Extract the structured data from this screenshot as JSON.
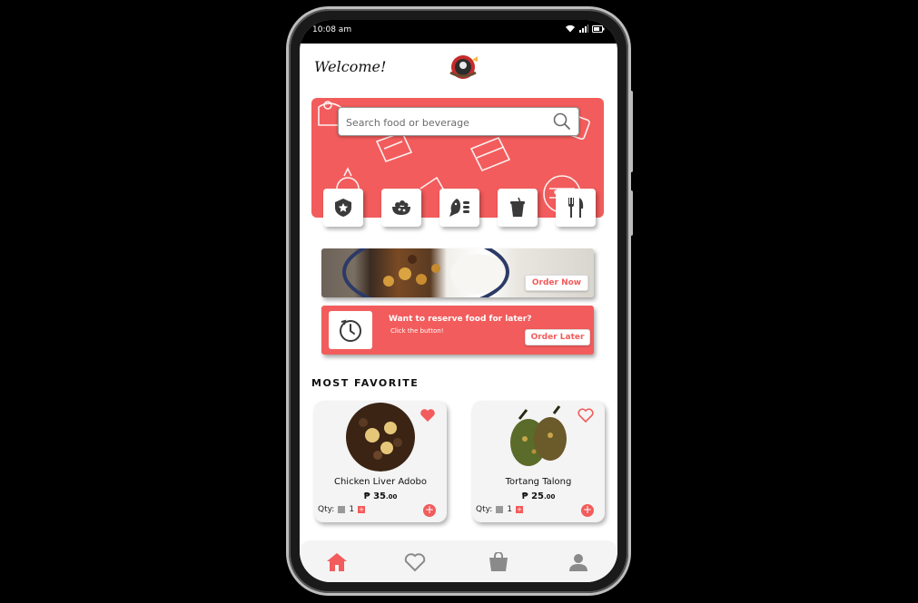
{
  "status_bar": {
    "time": "10:08 am"
  },
  "header": {
    "welcome": "Welcome!"
  },
  "search": {
    "placeholder": "Search food or beverage"
  },
  "categories": [
    {
      "icon": "star-badge-icon"
    },
    {
      "icon": "salad-bowl-icon"
    },
    {
      "icon": "fish-icon"
    },
    {
      "icon": "drink-cup-icon"
    },
    {
      "icon": "fork-knife-icon"
    }
  ],
  "promo_banner": {
    "button": "Order Now"
  },
  "reserve_banner": {
    "title": "Want to reserve food for later?",
    "subtitle": "Click the button!",
    "button": "Order Later"
  },
  "most_favorite": {
    "title": "MOST FAVORITE",
    "items": [
      {
        "name": "Chicken Liver Adobo",
        "currency": "₱",
        "price": "35",
        "cents": ".00",
        "qty_label": "Qty:",
        "qty": "1",
        "favorited": true
      },
      {
        "name": "Tortang Talong",
        "currency": "₱",
        "price": "25",
        "cents": ".00",
        "qty_label": "Qty:",
        "qty": "1",
        "favorited": false
      }
    ]
  },
  "bottom_nav": [
    {
      "icon": "home-icon",
      "active": true
    },
    {
      "icon": "heart-icon",
      "active": false
    },
    {
      "icon": "shopping-bag-icon",
      "active": false
    },
    {
      "icon": "profile-icon",
      "active": false
    }
  ],
  "colors": {
    "accent": "#f25c5c",
    "icon_dark": "#3a3a3a",
    "nav_inactive": "#8a8a8a"
  }
}
